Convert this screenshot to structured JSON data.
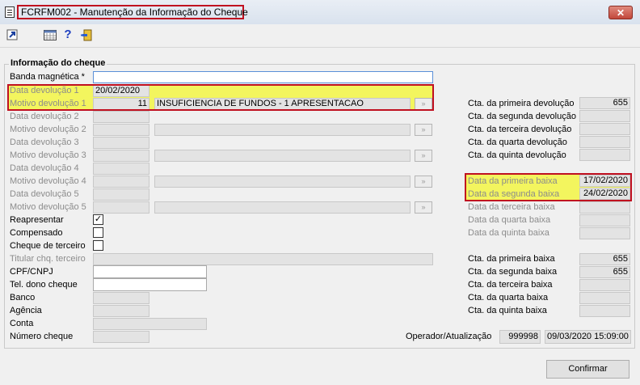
{
  "window": {
    "title": "FCRFM002 - Manutenção da Informação do Cheque",
    "close_glyph": "✕"
  },
  "toolbar": {
    "icons": [
      "export-icon",
      "calendar-icon",
      "help-icon",
      "exit-icon"
    ],
    "help_glyph": "?"
  },
  "group": {
    "title": "Informação do cheque"
  },
  "form": {
    "banda_label": "Banda magnética *",
    "banda_value": "",
    "devolucoes": [
      {
        "data_label": "Data devolução 1",
        "data_value": "20/02/2020",
        "motivo_label": "Motivo devolução 1",
        "motivo_code": "11",
        "motivo_desc": "INSUFICIENCIA DE FUNDOS - 1 APRESENTACAO"
      },
      {
        "data_label": "Data devolução 2",
        "data_value": "",
        "motivo_label": "Motivo devolução 2",
        "motivo_code": "",
        "motivo_desc": ""
      },
      {
        "data_label": "Data devolução 3",
        "data_value": "",
        "motivo_label": "Motivo devolução 3",
        "motivo_code": "",
        "motivo_desc": ""
      },
      {
        "data_label": "Data devolução 4",
        "data_value": "",
        "motivo_label": "Motivo devolução 4",
        "motivo_code": "",
        "motivo_desc": ""
      },
      {
        "data_label": "Data devolução 5",
        "data_value": "",
        "motivo_label": "Motivo devolução 5",
        "motivo_code": "",
        "motivo_desc": ""
      }
    ],
    "lookup_glyph": "»",
    "reapresentar_label": "Reapresentar",
    "reapresentar_checked": true,
    "check_glyph": "✓",
    "compensado_label": "Compensado",
    "cheque_terceiro_label": "Cheque de terceiro",
    "titular_label": "Titular chq. terceiro",
    "cpf_label": "CPF/CNPJ",
    "tel_label": "Tel. dono cheque",
    "banco_label": "Banco",
    "agencia_label": "Agência",
    "conta_label": "Conta",
    "numero_label": "Número cheque",
    "operador_label": "Operador/Atualização",
    "operador_value": "999998",
    "atualizacao_value": "09/03/2020 15:09:00"
  },
  "right_panel": {
    "cta_devolucao": [
      {
        "label": "Cta. da primeira devolução",
        "value": "655"
      },
      {
        "label": "Cta. da segunda devolução",
        "value": ""
      },
      {
        "label": "Cta. da terceira devolução",
        "value": ""
      },
      {
        "label": "Cta. da quarta devolução",
        "value": ""
      },
      {
        "label": "Cta. da quinta devolução",
        "value": ""
      }
    ],
    "data_baixa": [
      {
        "label": "Data da primeira baixa",
        "value": "17/02/2020"
      },
      {
        "label": "Data da segunda baixa",
        "value": "24/02/2020"
      },
      {
        "label": "Data da terceira baixa",
        "value": ""
      },
      {
        "label": "Data da quarta baixa",
        "value": ""
      },
      {
        "label": "Data da quinta baixa",
        "value": ""
      }
    ],
    "cta_baixa": [
      {
        "label": "Cta. da primeira baixa",
        "value": "655"
      },
      {
        "label": "Cta. da segunda baixa",
        "value": "655"
      },
      {
        "label": "Cta. da terceira baixa",
        "value": ""
      },
      {
        "label": "Cta. da quarta baixa",
        "value": ""
      },
      {
        "label": "Cta. da quinta baixa",
        "value": ""
      }
    ]
  },
  "buttons": {
    "confirmar": "Confirmar"
  },
  "colors": {
    "highlight_yellow": "#f3f55e",
    "annotation_red": "#c01020"
  }
}
